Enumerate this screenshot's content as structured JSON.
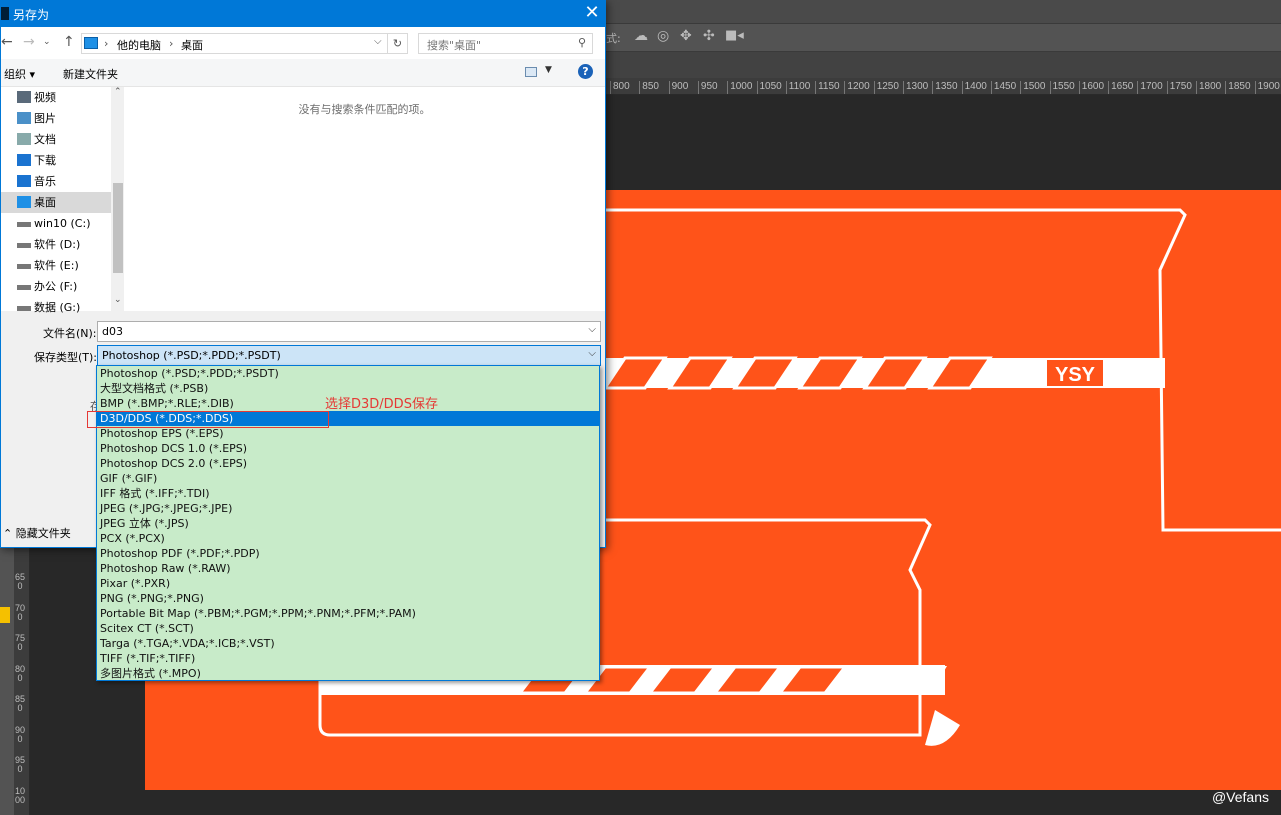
{
  "photoshop": {
    "options_label": "式:",
    "ruler_h": [
      "800",
      "850",
      "900",
      "950",
      "1000",
      "1050",
      "1100",
      "1150",
      "1200",
      "1250",
      "1300",
      "1350",
      "1400",
      "1450",
      "1500",
      "1550",
      "1600",
      "1650",
      "1700",
      "1750",
      "1800",
      "1850",
      "1900"
    ],
    "ruler_v": [
      "650",
      "700",
      "750",
      "800",
      "850",
      "900",
      "950",
      "1000"
    ],
    "canvas_color": "#ff5319",
    "artwork_text": "YSY",
    "watermark": "@Vefans"
  },
  "dialog": {
    "title": "另存为",
    "close": "✕",
    "breadcrumb": [
      "他的电脑",
      "桌面"
    ],
    "search_placeholder": "搜索\"桌面\"",
    "toolbar": {
      "organize": "组织 ▾",
      "new_folder": "新建文件夹",
      "help": "?"
    },
    "nav_items": [
      {
        "label": "视频",
        "icon": "video-icon"
      },
      {
        "label": "图片",
        "icon": "picture-icon"
      },
      {
        "label": "文档",
        "icon": "document-icon"
      },
      {
        "label": "下载",
        "icon": "download-icon"
      },
      {
        "label": "音乐",
        "icon": "music-icon"
      },
      {
        "label": "桌面",
        "icon": "desktop-icon",
        "selected": true
      },
      {
        "label": "win10 (C:)",
        "icon": "drive-icon"
      },
      {
        "label": "软件 (D:)",
        "icon": "drive-icon"
      },
      {
        "label": "软件 (E:)",
        "icon": "drive-icon"
      },
      {
        "label": "办公 (F:)",
        "icon": "drive-icon"
      },
      {
        "label": "数据 (G:)",
        "icon": "drive-icon"
      }
    ],
    "empty_message": "没有与搜索条件匹配的项。",
    "filename_label": "文件名(N):",
    "filename_value": "d03",
    "filetype_label": "保存类型(T):",
    "filetype_value": "Photoshop (*.PSD;*.PDD;*.PSDT)",
    "hidden_label": "存",
    "hide_folders": "隐藏文件夹",
    "filetype_options": [
      "Photoshop (*.PSD;*.PDD;*.PSDT)",
      "大型文档格式 (*.PSB)",
      "BMP (*.BMP;*.RLE;*.DIB)",
      "D3D/DDS (*.DDS;*.DDS)",
      "Photoshop EPS (*.EPS)",
      "Photoshop DCS 1.0 (*.EPS)",
      "Photoshop DCS 2.0 (*.EPS)",
      "GIF (*.GIF)",
      "IFF 格式 (*.IFF;*.TDI)",
      "JPEG (*.JPG;*.JPEG;*.JPE)",
      "JPEG 立体 (*.JPS)",
      "PCX (*.PCX)",
      "Photoshop PDF (*.PDF;*.PDP)",
      "Photoshop Raw (*.RAW)",
      "Pixar (*.PXR)",
      "PNG (*.PNG;*.PNG)",
      "Portable Bit Map (*.PBM;*.PGM;*.PPM;*.PNM;*.PFM;*.PAM)",
      "Scitex CT (*.SCT)",
      "Targa (*.TGA;*.VDA;*.ICB;*.VST)",
      "TIFF (*.TIF;*.TIFF)",
      "多图片格式 (*.MPO)"
    ],
    "selected_option_index": 3,
    "annotation": "选择D3D/DDS保存"
  }
}
